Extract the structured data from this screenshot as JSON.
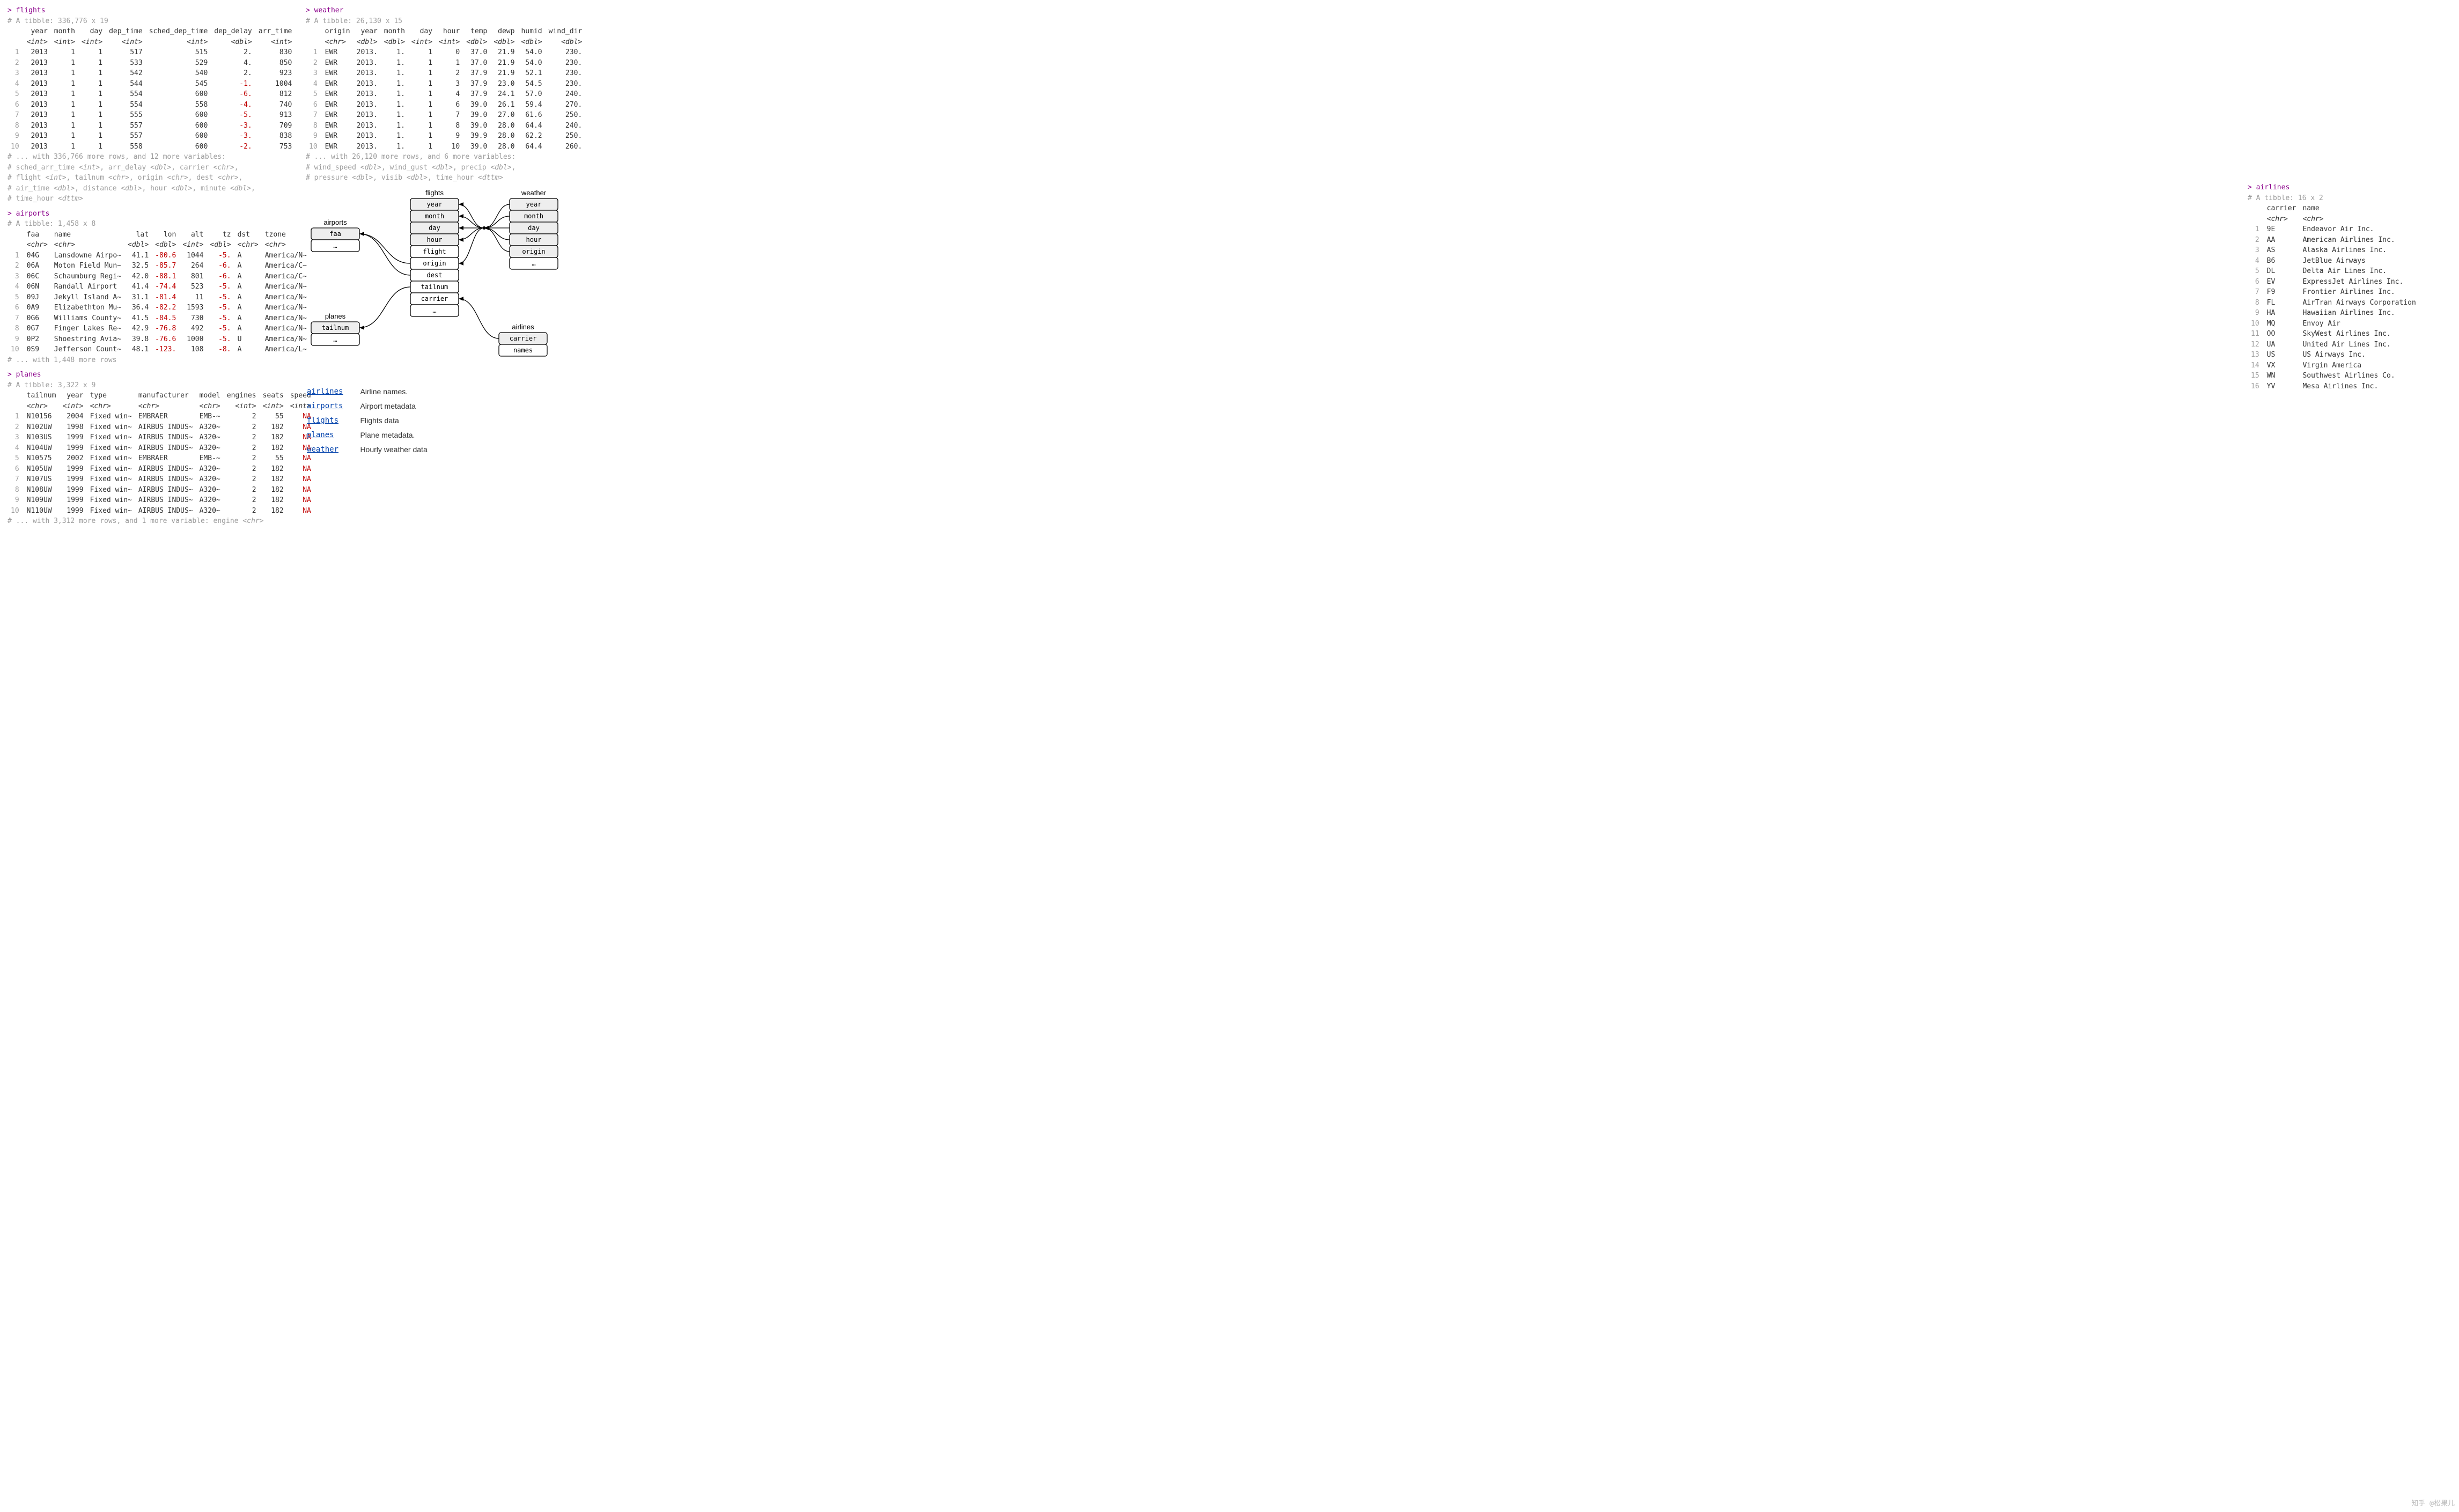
{
  "flights": {
    "cmd": "> flights",
    "dim": "# A tibble: 336,776 x 19",
    "cols": [
      "year",
      "month",
      "day",
      "dep_time",
      "sched_dep_time",
      "dep_delay",
      "arr_time"
    ],
    "types": [
      "<int>",
      "<int>",
      "<int>",
      "<int>",
      "<int>",
      "<dbl>",
      "<int>"
    ],
    "rows": [
      [
        "2013",
        "1",
        "1",
        "517",
        "515",
        "2.",
        "830"
      ],
      [
        "2013",
        "1",
        "1",
        "533",
        "529",
        "4.",
        "850"
      ],
      [
        "2013",
        "1",
        "1",
        "542",
        "540",
        "2.",
        "923"
      ],
      [
        "2013",
        "1",
        "1",
        "544",
        "545",
        "-1.",
        "1004"
      ],
      [
        "2013",
        "1",
        "1",
        "554",
        "600",
        "-6.",
        "812"
      ],
      [
        "2013",
        "1",
        "1",
        "554",
        "558",
        "-4.",
        "740"
      ],
      [
        "2013",
        "1",
        "1",
        "555",
        "600",
        "-5.",
        "913"
      ],
      [
        "2013",
        "1",
        "1",
        "557",
        "600",
        "-3.",
        "709"
      ],
      [
        "2013",
        "1",
        "1",
        "557",
        "600",
        "-3.",
        "838"
      ],
      [
        "2013",
        "1",
        "1",
        "558",
        "600",
        "-2.",
        "753"
      ]
    ],
    "footer": [
      "# ... with 336,766 more rows, and 12 more variables:",
      "#   sched_arr_time <int>, arr_delay <dbl>, carrier <chr>,",
      "#   flight <int>, tailnum <chr>, origin <chr>, dest <chr>,",
      "#   air_time <dbl>, distance <dbl>, hour <dbl>, minute <dbl>,",
      "#   time_hour <dttm>"
    ]
  },
  "weather": {
    "cmd": "> weather",
    "dim": "# A tibble: 26,130 x 15",
    "cols": [
      "origin",
      "year",
      "month",
      "day",
      "hour",
      "temp",
      "dewp",
      "humid",
      "wind_dir"
    ],
    "types": [
      "<chr>",
      "<dbl>",
      "<dbl>",
      "<int>",
      "<int>",
      "<dbl>",
      "<dbl>",
      "<dbl>",
      "<dbl>"
    ],
    "rows": [
      [
        "EWR",
        "2013.",
        "1.",
        "1",
        "0",
        "37.0",
        "21.9",
        "54.0",
        "230."
      ],
      [
        "EWR",
        "2013.",
        "1.",
        "1",
        "1",
        "37.0",
        "21.9",
        "54.0",
        "230."
      ],
      [
        "EWR",
        "2013.",
        "1.",
        "1",
        "2",
        "37.9",
        "21.9",
        "52.1",
        "230."
      ],
      [
        "EWR",
        "2013.",
        "1.",
        "1",
        "3",
        "37.9",
        "23.0",
        "54.5",
        "230."
      ],
      [
        "EWR",
        "2013.",
        "1.",
        "1",
        "4",
        "37.9",
        "24.1",
        "57.0",
        "240."
      ],
      [
        "EWR",
        "2013.",
        "1.",
        "1",
        "6",
        "39.0",
        "26.1",
        "59.4",
        "270."
      ],
      [
        "EWR",
        "2013.",
        "1.",
        "1",
        "7",
        "39.0",
        "27.0",
        "61.6",
        "250."
      ],
      [
        "EWR",
        "2013.",
        "1.",
        "1",
        "8",
        "39.0",
        "28.0",
        "64.4",
        "240."
      ],
      [
        "EWR",
        "2013.",
        "1.",
        "1",
        "9",
        "39.9",
        "28.0",
        "62.2",
        "250."
      ],
      [
        "EWR",
        "2013.",
        "1.",
        "1",
        "10",
        "39.0",
        "28.0",
        "64.4",
        "260."
      ]
    ],
    "footer": [
      "# ... with 26,120 more rows, and 6 more variables:",
      "#   wind_speed <dbl>, wind_gust <dbl>, precip <dbl>,",
      "#   pressure <dbl>, visib <dbl>, time_hour <dttm>"
    ]
  },
  "airports": {
    "cmd": "> airports",
    "dim": "# A tibble: 1,458 x 8",
    "cols": [
      "faa",
      "name",
      "lat",
      "lon",
      "alt",
      "tz",
      "dst",
      "tzone"
    ],
    "types": [
      "<chr>",
      "<chr>",
      "<dbl>",
      "<dbl>",
      "<int>",
      "<dbl>",
      "<chr>",
      "<chr>"
    ],
    "rows": [
      [
        "04G",
        "Lansdowne Airpo~",
        "41.1",
        "-80.6",
        "1044",
        "-5.",
        "A",
        "America/N~"
      ],
      [
        "06A",
        "Moton Field Mun~",
        "32.5",
        "-85.7",
        "264",
        "-6.",
        "A",
        "America/C~"
      ],
      [
        "06C",
        "Schaumburg Regi~",
        "42.0",
        "-88.1",
        "801",
        "-6.",
        "A",
        "America/C~"
      ],
      [
        "06N",
        "Randall Airport",
        "41.4",
        "-74.4",
        "523",
        "-5.",
        "A",
        "America/N~"
      ],
      [
        "09J",
        "Jekyll Island A~",
        "31.1",
        "-81.4",
        "11",
        "-5.",
        "A",
        "America/N~"
      ],
      [
        "0A9",
        "Elizabethton Mu~",
        "36.4",
        "-82.2",
        "1593",
        "-5.",
        "A",
        "America/N~"
      ],
      [
        "0G6",
        "Williams County~",
        "41.5",
        "-84.5",
        "730",
        "-5.",
        "A",
        "America/N~"
      ],
      [
        "0G7",
        "Finger Lakes Re~",
        "42.9",
        "-76.8",
        "492",
        "-5.",
        "A",
        "America/N~"
      ],
      [
        "0P2",
        "Shoestring Avia~",
        "39.8",
        "-76.6",
        "1000",
        "-5.",
        "U",
        "America/N~"
      ],
      [
        "0S9",
        "Jefferson Count~",
        "48.1",
        "-123.",
        "108",
        "-8.",
        "A",
        "America/L~"
      ]
    ],
    "footer": [
      "# ... with 1,448 more rows"
    ]
  },
  "planes": {
    "cmd": "> planes",
    "dim": "# A tibble: 3,322 x 9",
    "cols": [
      "tailnum",
      "year",
      "type",
      "manufacturer",
      "model",
      "engines",
      "seats",
      "speed"
    ],
    "types": [
      "<chr>",
      "<int>",
      "<chr>",
      "<chr>",
      "<chr>",
      "<int>",
      "<int>",
      "<int>"
    ],
    "rows": [
      [
        "N10156",
        "2004",
        "Fixed win~",
        "EMBRAER",
        "EMB-~",
        "2",
        "55",
        "NA"
      ],
      [
        "N102UW",
        "1998",
        "Fixed win~",
        "AIRBUS INDUS~",
        "A320~",
        "2",
        "182",
        "NA"
      ],
      [
        "N103US",
        "1999",
        "Fixed win~",
        "AIRBUS INDUS~",
        "A320~",
        "2",
        "182",
        "NA"
      ],
      [
        "N104UW",
        "1999",
        "Fixed win~",
        "AIRBUS INDUS~",
        "A320~",
        "2",
        "182",
        "NA"
      ],
      [
        "N10575",
        "2002",
        "Fixed win~",
        "EMBRAER",
        "EMB-~",
        "2",
        "55",
        "NA"
      ],
      [
        "N105UW",
        "1999",
        "Fixed win~",
        "AIRBUS INDUS~",
        "A320~",
        "2",
        "182",
        "NA"
      ],
      [
        "N107US",
        "1999",
        "Fixed win~",
        "AIRBUS INDUS~",
        "A320~",
        "2",
        "182",
        "NA"
      ],
      [
        "N108UW",
        "1999",
        "Fixed win~",
        "AIRBUS INDUS~",
        "A320~",
        "2",
        "182",
        "NA"
      ],
      [
        "N109UW",
        "1999",
        "Fixed win~",
        "AIRBUS INDUS~",
        "A320~",
        "2",
        "182",
        "NA"
      ],
      [
        "N110UW",
        "1999",
        "Fixed win~",
        "AIRBUS INDUS~",
        "A320~",
        "2",
        "182",
        "NA"
      ]
    ],
    "footer": [
      "# ... with 3,312 more rows, and 1 more variable: engine <chr>"
    ]
  },
  "airlines": {
    "cmd": "> airlines",
    "dim": "# A tibble: 16 x 2",
    "cols": [
      "carrier",
      "name"
    ],
    "types": [
      "<chr>",
      "<chr>"
    ],
    "rows": [
      [
        "9E",
        "Endeavor Air Inc."
      ],
      [
        "AA",
        "American Airlines Inc."
      ],
      [
        "AS",
        "Alaska Airlines Inc."
      ],
      [
        "B6",
        "JetBlue Airways"
      ],
      [
        "DL",
        "Delta Air Lines Inc."
      ],
      [
        "EV",
        "ExpressJet Airlines Inc."
      ],
      [
        "F9",
        "Frontier Airlines Inc."
      ],
      [
        "FL",
        "AirTran Airways Corporation"
      ],
      [
        "HA",
        "Hawaiian Airlines Inc."
      ],
      [
        "MQ",
        "Envoy Air"
      ],
      [
        "OO",
        "SkyWest Airlines Inc."
      ],
      [
        "UA",
        "United Air Lines Inc."
      ],
      [
        "US",
        "US Airways Inc."
      ],
      [
        "VX",
        "Virgin America"
      ],
      [
        "WN",
        "Southwest Airlines Co."
      ],
      [
        "YV",
        "Mesa Airlines Inc."
      ]
    ]
  },
  "diagram": {
    "airports": {
      "title": "airports",
      "fields": [
        "faa",
        "…"
      ]
    },
    "planes": {
      "title": "planes",
      "fields": [
        "tailnum",
        "…"
      ]
    },
    "flights": {
      "title": "flights",
      "fields": [
        "year",
        "month",
        "day",
        "hour",
        "flight",
        "origin",
        "dest",
        "tailnum",
        "carrier",
        "…"
      ]
    },
    "weather": {
      "title": "weather",
      "fields": [
        "year",
        "month",
        "day",
        "hour",
        "origin",
        "…"
      ]
    },
    "airlines": {
      "title": "airlines",
      "fields": [
        "carrier",
        "names"
      ]
    }
  },
  "links": [
    {
      "name": "airlines",
      "desc": "Airline names."
    },
    {
      "name": "airports",
      "desc": "Airport metadata"
    },
    {
      "name": "flights",
      "desc": "Flights data"
    },
    {
      "name": "planes",
      "desc": "Plane metadata."
    },
    {
      "name": "weather",
      "desc": "Hourly weather data"
    }
  ],
  "leftcols": {
    "flights": [],
    "airports": [
      0,
      1,
      6,
      7
    ],
    "planes": [
      0,
      2,
      3,
      4
    ],
    "weather": [
      0
    ],
    "airlines": [
      0,
      1
    ]
  },
  "watermark": "知乎 @松果儿"
}
